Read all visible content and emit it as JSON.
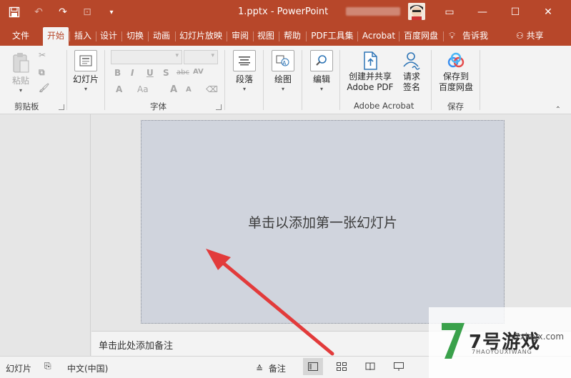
{
  "window": {
    "doc_title": "1.pptx  -  PowerPoint",
    "restore_label": "▭",
    "minimize_label": "—",
    "maximize_label": "☐",
    "close_label": "✕"
  },
  "tabs": [
    {
      "label": "文件",
      "active": false
    },
    {
      "label": "开始",
      "active": true
    },
    {
      "label": "插入",
      "active": false
    },
    {
      "label": "设计",
      "active": false
    },
    {
      "label": "切换",
      "active": false
    },
    {
      "label": "动画",
      "active": false
    },
    {
      "label": "幻灯片放映",
      "active": false
    },
    {
      "label": "审阅",
      "active": false
    },
    {
      "label": "视图",
      "active": false
    },
    {
      "label": "帮助",
      "active": false
    },
    {
      "label": "PDF工具集",
      "active": false
    },
    {
      "label": "Acrobat",
      "active": false
    },
    {
      "label": "百度网盘",
      "active": false
    }
  ],
  "tell_me": "告诉我",
  "share": "共享",
  "ribbon": {
    "clipboard": {
      "paste": "粘贴",
      "group_label": "剪贴板"
    },
    "slides": {
      "new_slide": "幻灯片"
    },
    "font": {
      "group_label": "字体",
      "bold": "B",
      "italic": "I",
      "underline": "U",
      "shadow": "S",
      "strike": "abc",
      "spacing": "AV",
      "font_color": "A",
      "case": "Aa",
      "grow": "A",
      "shrink": "A"
    },
    "paragraph": {
      "label": "段落"
    },
    "drawing": {
      "label": "绘图"
    },
    "editing": {
      "label": "编辑"
    },
    "acrobat": {
      "create_line1": "创建并共享",
      "create_line2": "Adobe PDF",
      "sign_line1": "请求",
      "sign_line2": "签名",
      "group_label": "Adobe Acrobat"
    },
    "save": {
      "line1": "保存到",
      "line2": "百度网盘",
      "group_label": "保存"
    }
  },
  "slide": {
    "placeholder": "单击以添加第一张幻灯片"
  },
  "notes": {
    "placeholder": "单击此处添加备注"
  },
  "statusbar": {
    "slide": "幻灯片",
    "language": "中文(中国)",
    "notes": "备注"
  },
  "watermark": {
    "brand": "7号游戏",
    "pinyin": "7HAOYOUXIWANG",
    "url": "7xiayx.com"
  },
  "colors": {
    "accent": "#b7472a",
    "arrow": "#e23b3b"
  }
}
